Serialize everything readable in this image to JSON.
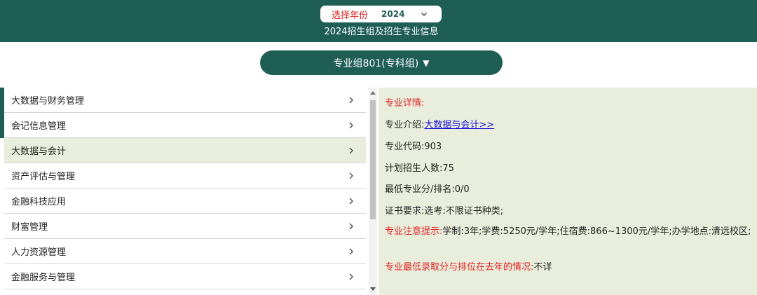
{
  "header": {
    "year_label": "选择年份",
    "year_value": "2024",
    "title": "2024招生组及招生专业信息"
  },
  "group": {
    "label": "专业组801(专科组)"
  },
  "majors": [
    {
      "label": "大数据与财务管理"
    },
    {
      "label": "会记信息管理"
    },
    {
      "label": "大数据与会计"
    },
    {
      "label": "资产评估与管理"
    },
    {
      "label": "金融科技应用"
    },
    {
      "label": "财富管理"
    },
    {
      "label": "人力资源管理"
    },
    {
      "label": "金融服务与管理"
    }
  ],
  "details": {
    "heading": "专业详情:",
    "intro_label": "专业介绍:",
    "intro_link": "大数据与会计>>",
    "code": "专业代码:903",
    "plan": "计划招生人数:75",
    "min_score": "最低专业分/排名:0/0",
    "cert": "证书要求:选考:不限证书种类;",
    "notice_label": "专业注意提示:",
    "notice_text": "学制:3年;学费:5250元/学年;住宿费:866~1300元/学年;办学地点:清远校区;",
    "last_year_label": "专业最低录取分与排位在去年的情况:",
    "last_year_value": "不详"
  },
  "colors": {
    "brand": "#1f5e55",
    "accent_red": "#e02020",
    "panel_bg": "#e9eedc",
    "link": "#1a10d6"
  },
  "icons": {
    "year_dropdown": "chevron-down-icon",
    "group_dropdown": "triangle-down-icon",
    "list_item": "chevron-right-icon"
  }
}
